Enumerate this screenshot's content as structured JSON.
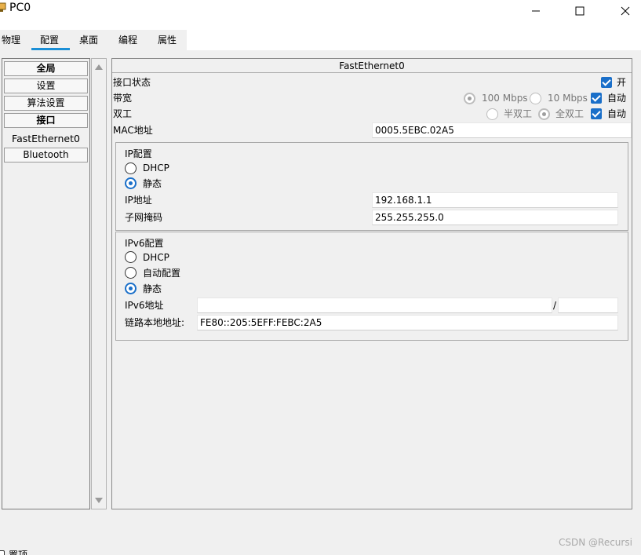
{
  "window": {
    "title": "PC0",
    "minimize": "—",
    "maximize": "☐",
    "close": "✕"
  },
  "tabs": [
    {
      "label": "物理"
    },
    {
      "label": "配置",
      "active": true
    },
    {
      "label": "桌面"
    },
    {
      "label": "编程"
    },
    {
      "label": "属性"
    }
  ],
  "sidebar": {
    "items": [
      {
        "label": "全局",
        "style": "bold"
      },
      {
        "label": "设置"
      },
      {
        "label": "算法设置"
      },
      {
        "label": "接口",
        "style": "bold"
      },
      {
        "label": "FastEthernet0",
        "selected": true
      },
      {
        "label": "Bluetooth"
      }
    ]
  },
  "panel": {
    "title": "FastEthernet0",
    "port_status_label": "接口状态",
    "port_on_label": "开",
    "bandwidth_label": "带宽",
    "bw_100": "100 Mbps",
    "bw_10": "10 Mbps",
    "bw_auto": "自动",
    "duplex_label": "双工",
    "duplex_half": "半双工",
    "duplex_full": "全双工",
    "duplex_auto": "自动",
    "mac_label": "MAC地址",
    "mac_value": "0005.5EBC.02A5"
  },
  "ipv4": {
    "title": "IP配置",
    "dhcp": "DHCP",
    "static": "静态",
    "ip_label": "IP地址",
    "ip_value": "192.168.1.1",
    "mask_label": "子网掩码",
    "mask_value": "255.255.255.0"
  },
  "ipv6": {
    "title": "IPv6配置",
    "dhcp": "DHCP",
    "auto": "自动配置",
    "static": "静态",
    "addr_label": "IPv6地址",
    "addr_value": "",
    "slash": "/",
    "prefix_value": "",
    "link_local_label": "链路本地地址:",
    "link_local_value": "FE80::205:5EFF:FEBC:2A5"
  },
  "bottom": {
    "top_label": "置顶",
    "watermark": "CSDN @Recursi"
  },
  "colors": {
    "accent": "#1a6fc9",
    "tab_underline": "#1b8fd6"
  }
}
